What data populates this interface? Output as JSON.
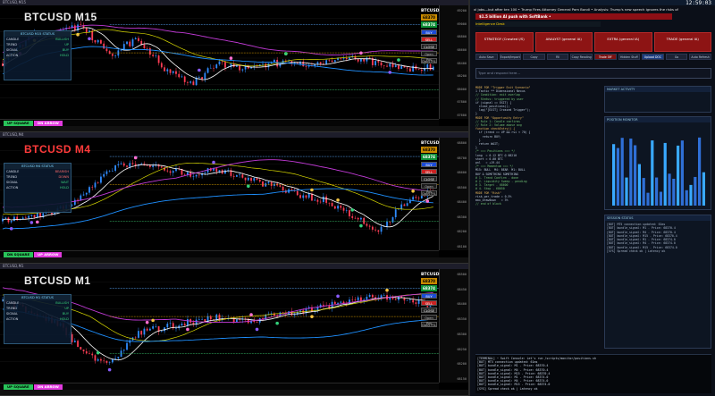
{
  "panes": [
    {
      "title": "BTCUSD,M15",
      "symbol": "BTCUSD M15",
      "symbol_color": "#eaeaea",
      "box_head": "BTCUSD M15 STATUS",
      "box_rows": [
        [
          "CANDLE",
          "BULLISH"
        ],
        [
          "TREND",
          "UP"
        ],
        [
          "SIGNAL",
          "BUY"
        ],
        [
          "ACTION",
          "HOLD"
        ]
      ],
      "side_tag": "BTCUSD",
      "side_price": "68370",
      "side_price2": "68374",
      "buttons": [
        "BUY",
        "SELL",
        "CLOSE",
        "Open Pos",
        "Daily P/L"
      ],
      "pill_left": "UP SQUARE",
      "pill_right": "DN ARROW",
      "ticks": [
        "69200",
        "69000",
        "68800",
        "68600",
        "68400",
        "68200",
        "68000",
        "67800",
        "67600"
      ]
    },
    {
      "title": "BTCUSD,M4",
      "symbol": "BTCUSD M4",
      "symbol_color": "#ff3b3b",
      "box_head": "BTCUSD M4 STATUS",
      "box_rows": [
        [
          "CANDLE",
          "BEARISH"
        ],
        [
          "TREND",
          "DOWN"
        ],
        [
          "SIGNAL",
          "WAIT"
        ],
        [
          "ACTION",
          "HOLD"
        ]
      ],
      "side_tag": "BTCUSD",
      "side_price": "68370",
      "side_price2": "68374",
      "buttons": [
        "BUY",
        "SELL",
        "CLOSE",
        "Open Pos",
        "Daily P/L"
      ],
      "pill_left": "DN SQUARE",
      "pill_right": "UP ARROW",
      "ticks": [
        "68800",
        "68700",
        "68600",
        "68500",
        "68400",
        "68300",
        "68200",
        "68100"
      ]
    },
    {
      "title": "BTCUSD,M1",
      "symbol": "BTCUSD M1",
      "symbol_color": "#eaeaea",
      "box_head": "BTCUSD M1 STATUS",
      "box_rows": [
        [
          "CANDLE",
          "BULLISH"
        ],
        [
          "TREND",
          "UP"
        ],
        [
          "SIGNAL",
          "BUY"
        ],
        [
          "ACTION",
          "HOLD"
        ]
      ],
      "side_tag": "BTCUSD",
      "side_price": "68370",
      "side_price2": "68374",
      "buttons": [
        "BUY",
        "SELL",
        "CLOSE",
        "Open Pos",
        "Daily P/L"
      ],
      "pill_left": "UP SQUARE",
      "pill_right": "DN ARROW",
      "ticks": [
        "68500",
        "68450",
        "68400",
        "68350",
        "68300",
        "68250",
        "68200",
        "68150"
      ]
    }
  ],
  "browser": {
    "clock": "12:59:03",
    "ticker": "xl jobs—but after ten 100 •  Trump Fires Attorney General Pam Bondi  •  Analysis: Trump's new speech ignores the risks of a return to the 1970s",
    "breaking": "$1.5 billion AI push with SoftBank •",
    "sub_headline": "Intelligence Desk",
    "nav": [
      "STRATEGY (Crawled I/S)",
      "ANALYST (general IA)",
      "EXTRA (general IA)",
      "TRADE (general IA)"
    ],
    "toolbar": [
      "Auto Save",
      "Export/Import",
      "Copy",
      "Fill",
      "Copy Reading",
      "Trade Off",
      "Hidden Stuff",
      "Upload DOC",
      "Go",
      "Auto Refresh"
    ],
    "chat_placeholder": "Type and respond here...",
    "code_lines": [
      "MODE FOR \"Trigger Exit Scenario\"",
      "1 Tactic ** Dimensional Nexus",
      "// Condition: exit overlap",
      "// Status: triggered by user",
      "if (signal == EXIT) {",
      "  close_positions();",
      "  log(\"[EXIT] Crossed Trigger\");",
      "}",
      "MODE FOR \"Opportunity Entry\"",
      "// Rule 1: Candle confirms",
      "// Rule 2: Volume above avg",
      "function checkEntry() {",
      "  if (trend == UP && rsi < 70) {",
      "    return BUY;",
      "  }",
      "  return WAIT;",
      "}",
      "/* === Positions === */",
      "long  = 0.12 BTC @ 68210",
      "short = 0.00 BTC",
      "pnl   = +19.44",
      "/* === Momentum === */",
      "M15: BULL  M4: BEAR  M1: BULL",
      "BUY & SOMETHING SOMETHING",
      "# 1. Trend Confirm - done",
      "# 2. Liquidity Sweep - pending",
      "# 3. Target - 68600",
      "# 4. Stop - 68050",
      "MODE FOR \"Risk\"",
      "risk_per_trade = 0.5%",
      "max_drawdown   = 3%",
      "// end of block"
    ],
    "widget1_title": "MARKET ACTIVITY",
    "widget2_title": "POSITION MONITOR",
    "widget3_title": "SESSION STATUS",
    "terminal_lines": [
      "[TERMINAL] ~ Swift Console: Let's run /scripts/monitor/positions.sh",
      "[BOT] MT5 connection updated: 61ms",
      "[BOT] bundle_signal: M1 - Price: 68370.4",
      "[BOT] bundle_signal: M4 - Price: 68370.4",
      "[BOT] bundle_signal: M15 - Price: 68370.4",
      "[BOT] bundle_signal: M1 - Price: 68374.0",
      "[BOT] bundle_signal: M4 - Price: 68374.0",
      "[BOT] bundle_signal: M15 - Price: 68374.0",
      "[SYS] Spread check ok | Latency ok"
    ]
  }
}
